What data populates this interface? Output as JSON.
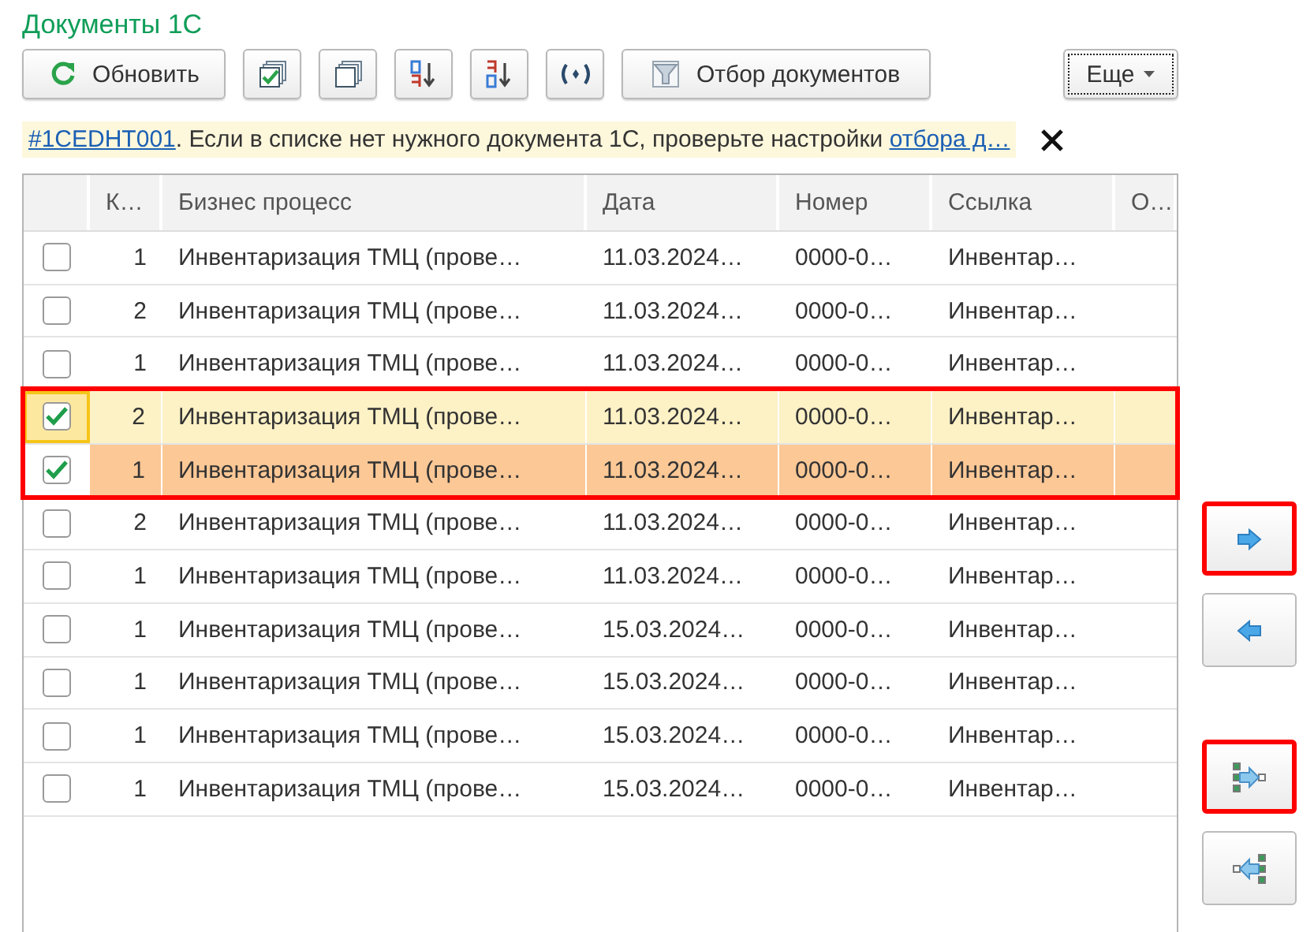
{
  "title": "Документы 1С",
  "toolbar": [
    {
      "kind": "refresh",
      "label": "Обновить"
    },
    {
      "kind": "check-all"
    },
    {
      "kind": "uncheck-all"
    },
    {
      "kind": "sort-asc"
    },
    {
      "kind": "sort-desc"
    },
    {
      "kind": "signal"
    },
    {
      "kind": "filter",
      "label": "Отбор документов"
    }
  ],
  "more_button": {
    "label": "Еще"
  },
  "info": {
    "code": "#1CEDHT001",
    "text": ". Если в списке нет нужного документа 1С, проверьте настройки ",
    "link": "отбора д…"
  },
  "table": {
    "columns": [
      "К…",
      "Бизнес процесс",
      "Дата",
      "Номер",
      "Ссылка",
      "О…"
    ],
    "rows": [
      {
        "checked": false,
        "selected": false,
        "current": false,
        "focused": false,
        "annotated": false,
        "cells": [
          "1",
          "Инвентаризация ТМЦ (прове…",
          "11.03.2024…",
          "0000-0…",
          "Инвентар…",
          ""
        ]
      },
      {
        "checked": false,
        "selected": false,
        "current": false,
        "focused": false,
        "annotated": false,
        "cells": [
          "2",
          "Инвентаризация ТМЦ (прове…",
          "11.03.2024…",
          "0000-0…",
          "Инвентар…",
          ""
        ]
      },
      {
        "checked": false,
        "selected": false,
        "current": false,
        "focused": false,
        "annotated": false,
        "cells": [
          "1",
          "Инвентаризация ТМЦ (прове…",
          "11.03.2024…",
          "0000-0…",
          "Инвентар…",
          ""
        ]
      },
      {
        "checked": true,
        "selected": true,
        "current": false,
        "focused": true,
        "annotated": true,
        "cells": [
          "2",
          "Инвентаризация ТМЦ (прове…",
          "11.03.2024…",
          "0000-0…",
          "Инвентар…",
          ""
        ]
      },
      {
        "checked": true,
        "selected": true,
        "current": true,
        "focused": false,
        "annotated": true,
        "cells": [
          "1",
          "Инвентаризация ТМЦ (прове…",
          "11.03.2024…",
          "0000-0…",
          "Инвентар…",
          ""
        ]
      },
      {
        "checked": false,
        "selected": false,
        "current": false,
        "focused": false,
        "annotated": false,
        "cells": [
          "2",
          "Инвентаризация ТМЦ (прове…",
          "11.03.2024…",
          "0000-0…",
          "Инвентар…",
          ""
        ]
      },
      {
        "checked": false,
        "selected": false,
        "current": false,
        "focused": false,
        "annotated": false,
        "cells": [
          "1",
          "Инвентаризация ТМЦ (прове…",
          "11.03.2024…",
          "0000-0…",
          "Инвентар…",
          ""
        ]
      },
      {
        "checked": false,
        "selected": false,
        "current": false,
        "focused": false,
        "annotated": false,
        "cells": [
          "1",
          "Инвентаризация ТМЦ (прове…",
          "15.03.2024…",
          "0000-0…",
          "Инвентар…",
          ""
        ]
      },
      {
        "checked": false,
        "selected": false,
        "current": false,
        "focused": false,
        "annotated": false,
        "cells": [
          "1",
          "Инвентаризация ТМЦ (прове…",
          "15.03.2024…",
          "0000-0…",
          "Инвентар…",
          ""
        ]
      },
      {
        "checked": false,
        "selected": false,
        "current": false,
        "focused": false,
        "annotated": false,
        "cells": [
          "1",
          "Инвентаризация ТМЦ (прове…",
          "15.03.2024…",
          "0000-0…",
          "Инвентар…",
          ""
        ]
      },
      {
        "checked": false,
        "selected": false,
        "current": false,
        "focused": false,
        "annotated": false,
        "cells": [
          "1",
          "Инвентаризация ТМЦ (прове…",
          "15.03.2024…",
          "0000-0…",
          "Инвентар…",
          ""
        ]
      }
    ]
  },
  "side_buttons": [
    {
      "kind": "move-right",
      "annotated": true
    },
    {
      "kind": "move-left",
      "annotated": false
    },
    {
      "kind": "move-all-right",
      "annotated": true
    },
    {
      "kind": "move-all-left",
      "annotated": false
    }
  ]
}
